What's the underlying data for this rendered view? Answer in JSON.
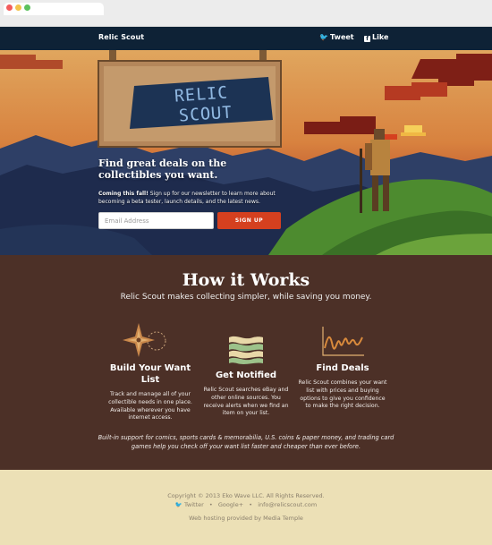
{
  "site": {
    "brand": "Relic Scout",
    "nav": {
      "tweet_label": "Tweet",
      "like_label": "Like"
    }
  },
  "hero": {
    "logo_text": "RELIC SCOUT",
    "headline": "Find great deals on the collectibles you want.",
    "coming_label": "Coming this fall!",
    "coming_text": "Sign up for our newsletter to learn more about becoming a beta tester, launch details, and the latest news.",
    "email_placeholder": "Email Address",
    "signup_label": "SIGN UP"
  },
  "how": {
    "title": "How it Works",
    "subtitle": "Relic Scout makes collecting simpler, while saving you money.",
    "features": [
      {
        "icon": "compass-icon",
        "title": "Build Your Want List",
        "desc": "Track and manage all of your collectible needs in one place. Available wherever you have internet access."
      },
      {
        "icon": "flag-icon",
        "title": "Get Notified",
        "desc": "Relic Scout searches eBay and other online sources. You receive alerts when we find an item on your list."
      },
      {
        "icon": "chart-icon",
        "title": "Find Deals",
        "desc": "Relic Scout combines your want list with prices and buying options to give you confidence to make the right decision."
      }
    ],
    "note": "Built-in support for comics, sports cards & memorabilia, U.S. coins & paper money, and trading card games help you check off your want list faster and cheaper than ever before."
  },
  "footer": {
    "copyright": "Copyright © 2013 Eko Wave LLC. All Rights Reserved.",
    "links": [
      "Twitter",
      "Google+",
      "info@relicscout.com"
    ],
    "hosting": "Web hosting provided by Media Temple"
  },
  "colors": {
    "navbar": "#0e2236",
    "how_bg": "#4c3027",
    "footer_bg": "#ece0b6",
    "signup": "#d5401f"
  }
}
